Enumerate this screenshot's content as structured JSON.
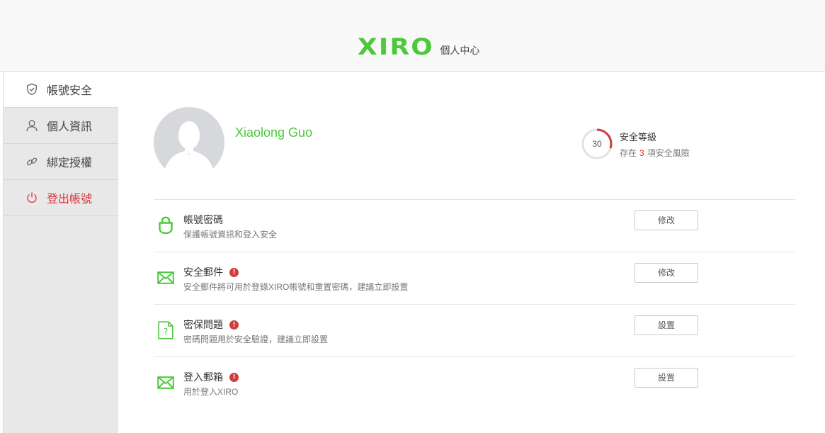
{
  "header": {
    "logo": "XIRO",
    "subtitle": "個人中心"
  },
  "colors": {
    "brand_green": "#4bc93a",
    "danger_red": "#d9343a",
    "sidebar_bg": "#e8e8e8"
  },
  "sidebar": {
    "items": [
      {
        "label": "帳號安全",
        "icon": "shield-icon"
      },
      {
        "label": "個人資訊",
        "icon": "user-icon"
      },
      {
        "label": "綁定授權",
        "icon": "link-icon"
      },
      {
        "label": "登出帳號",
        "icon": "power-icon"
      }
    ]
  },
  "profile": {
    "name": "Xiaolong Guo"
  },
  "security_level": {
    "score": "30",
    "score_fraction": 0.3,
    "title": "安全等級",
    "desc_prefix": "存在",
    "risk_count": "3",
    "desc_suffix": "項安全風險"
  },
  "items": [
    {
      "title": "帳號密碼",
      "desc": "保護帳號資訊和登入安全",
      "button": "修改",
      "icon": "lock-icon",
      "warning": false
    },
    {
      "title": "安全郵件",
      "desc": "安全郵件將可用於登錄XIRO帳號和重置密碼，建議立即設置",
      "button": "修改",
      "icon": "mail-icon",
      "warning": true
    },
    {
      "title": "密保問題",
      "desc": "密碼問題用於安全驗證，建議立即設置",
      "button": "設置",
      "icon": "question-doc-icon",
      "warning": true
    },
    {
      "title": "登入郵箱",
      "desc": "用於登入XIRO",
      "button": "設置",
      "icon": "mail-icon",
      "warning": true
    }
  ]
}
